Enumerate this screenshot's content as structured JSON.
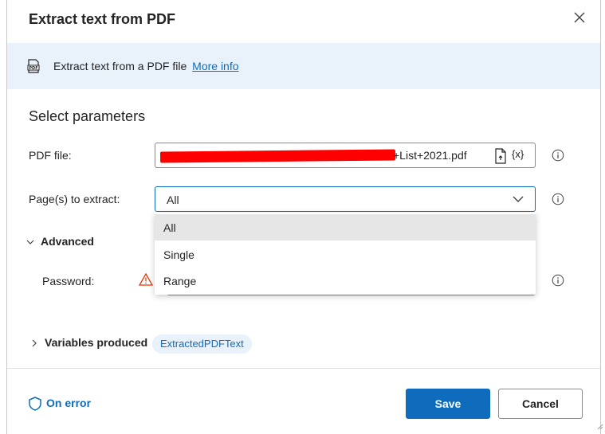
{
  "dialog": {
    "title": "Extract text from PDF",
    "banner_text": "Extract text from a PDF file",
    "banner_link": "More info"
  },
  "params": {
    "section_title": "Select parameters",
    "pdf_file_label": "PDF file:",
    "pdf_file_value_visible": "+List+2021.pdf",
    "var_picker": "{x}",
    "pages_label": "Page(s) to extract:",
    "pages_value": "All",
    "pages_options": [
      "All",
      "Single",
      "Range"
    ],
    "advanced_label": "Advanced",
    "password_label": "Password:"
  },
  "variables": {
    "label": "Variables produced",
    "items": [
      "ExtractedPDFText"
    ]
  },
  "footer": {
    "on_error": "On error",
    "save": "Save",
    "cancel": "Cancel"
  },
  "colors": {
    "accent": "#0f6cbd",
    "banner_bg": "#e9f1fb",
    "warning": "#d83b01"
  }
}
